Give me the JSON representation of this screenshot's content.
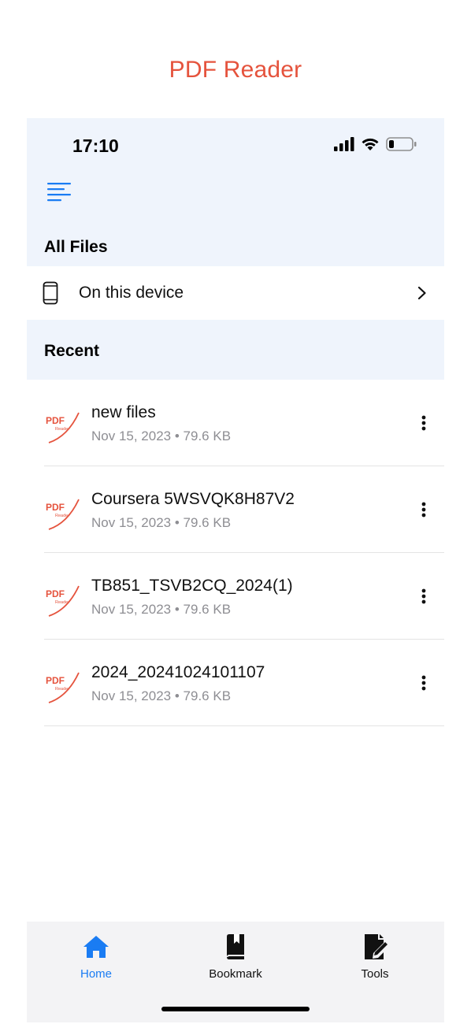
{
  "app_title": "PDF Reader",
  "status_bar": {
    "time": "17:10",
    "icons": [
      "cellular-signal-icon",
      "wifi-icon",
      "battery-icon"
    ]
  },
  "header": {
    "menu_icon": "menu-lines-icon",
    "all_files_title": "All Files"
  },
  "device_row": {
    "icon": "phone-icon",
    "label": "On this device",
    "chevron_icon": "chevron-right-icon"
  },
  "recent": {
    "title": "Recent",
    "thumb_text_top": "PDF",
    "thumb_text_bottom": "Reader",
    "files": [
      {
        "name": "new files",
        "date": "Nov 15, 2023",
        "size": "79.6 KB"
      },
      {
        "name": "Coursera 5WSVQK8H87V2",
        "date": "Nov 15, 2023",
        "size": "79.6 KB"
      },
      {
        "name": "TB851_TSVB2CQ_2024(1)",
        "date": "Nov 15, 2023",
        "size": "79.6 KB"
      },
      {
        "name": "2024_20241024101107",
        "date": "Nov 15, 2023",
        "size": "79.6 KB"
      }
    ]
  },
  "tabbar": {
    "tabs": [
      {
        "label": "Home",
        "icon": "home-icon",
        "active": true
      },
      {
        "label": "Bookmark",
        "icon": "bookmark-book-icon",
        "active": false
      },
      {
        "label": "Tools",
        "icon": "edit-document-icon",
        "active": false
      }
    ]
  },
  "colors": {
    "brand": "#E5533D",
    "accent": "#1A7CF3",
    "section_bg": "#EFF4FC",
    "tabbar_bg": "#F3F3F5",
    "meta_text": "#8E8E93"
  }
}
